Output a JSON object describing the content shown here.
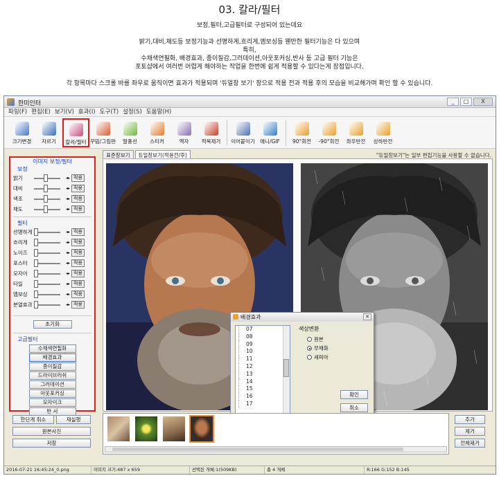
{
  "intro": {
    "heading": "03. 칼라/필터",
    "line1": "보정,필터,고급필터로 구성되어 있는데요",
    "line2": "밝기,대비,채도등 보정기능과 선명하게,흐리게,엠보싱등 웬만한 필터기능은 다 있으며",
    "line3": "특히,",
    "line4": "수채색연필화, 배경효과, 종이질감,그러데이션,아웃포커싱,반사 등 고급 필터 기능은",
    "line5": "포토샵에서 여러번 어렵게 해야하는 작업을 한번에 쉽게 적용할 수 있다는게 장점입니다.",
    "line6": "각 항목마다 스크롤 바를 좌우로 움직이면  효과가 적용되며 '듀얼창 보기' 창으로 적용 전과 적용 후의 모습을 비교해가며 확인 할 수 있습니다."
  },
  "window": {
    "title": "한미인터",
    "controls": [
      "_",
      "□",
      "X"
    ]
  },
  "menu": [
    "파일(F)",
    "편집(E)",
    "보기(V)",
    "효과(I)",
    "도구(T)",
    "설정(S)",
    "도움말(H)"
  ],
  "toolbar": [
    {
      "label": "크기변경",
      "icon": "resize-icon",
      "color": "#4a77c9"
    },
    {
      "label": "자르기",
      "icon": "crop-icon",
      "color": "#3c6fb8"
    },
    {
      "label": "칼라/필터",
      "icon": "color-filter-icon",
      "color": "#c84d7e",
      "selected": true
    },
    {
      "label": "꾸밈/그림판",
      "icon": "paint-icon",
      "color": "#d95e2e"
    },
    {
      "label": "말풍선",
      "icon": "speech-bubble-icon",
      "color": "#6fb83a"
    },
    {
      "label": "스티커",
      "icon": "sticker-icon",
      "color": "#e27b2b"
    },
    {
      "label": "액자",
      "icon": "frame-icon",
      "color": "#8a6fb0"
    },
    {
      "label": "적목제거",
      "icon": "red-eye-icon",
      "color": "#c8402a"
    },
    {
      "label": "이어붙이기",
      "icon": "merge-icon",
      "color": "#4d6fb0"
    },
    {
      "label": "애니/GIF",
      "icon": "gif-icon",
      "color": "#2f7fc9"
    },
    {
      "label": "90°회전",
      "icon": "rotate-right-icon",
      "color": "#e8a02b"
    },
    {
      "label": "-90°회전",
      "icon": "rotate-left-icon",
      "color": "#e8a02b"
    },
    {
      "label": "좌우반전",
      "icon": "flip-horizontal-icon",
      "color": "#e8a02b"
    },
    {
      "label": "상하반전",
      "icon": "flip-vertical-icon",
      "color": "#e8a02b"
    }
  ],
  "left_panel": {
    "title": "이미지 보정/필터",
    "correction_title": "보정",
    "correction": [
      {
        "label": "밝기",
        "level": 0.45
      },
      {
        "label": "대비",
        "level": 0.45
      },
      {
        "label": "색조",
        "level": 0.45
      },
      {
        "label": "채도",
        "level": 0.45
      }
    ],
    "filter_title": "필터",
    "filters": [
      {
        "label": "선명하게",
        "level": 0.0
      },
      {
        "label": "흐리게",
        "level": 0.0
      },
      {
        "label": "노이즈",
        "level": 0.0
      },
      {
        "label": "포스터",
        "level": 0.0
      },
      {
        "label": "모자이",
        "level": 0.0
      },
      {
        "label": "타일",
        "level": 0.0
      },
      {
        "label": "엠보싱",
        "level": 0.0
      },
      {
        "label": "분열효과",
        "level": 0.0
      }
    ],
    "apply_label": "적용",
    "reset_label": "초기화",
    "advanced_title": "고급필터",
    "advanced": [
      "수채색연필화",
      "배경효과",
      "종이질감",
      "드라이브러쉬",
      "그러데이션",
      "아웃포커싱",
      "모자이크",
      "반        사"
    ]
  },
  "tabs": [
    "표준창보기",
    "듀얼창보기(적용전/후)"
  ],
  "note": "\"듀얼창보기\"는 일부 편집기능을 사용할 수 없습니다.",
  "dialog": {
    "title": "배경효과",
    "list": [
      "07",
      "08",
      "09",
      "10",
      "11",
      "12",
      "13",
      "14",
      "15",
      "16",
      "17"
    ],
    "color_title": "색상변환",
    "options": [
      {
        "label": "원본",
        "checked": false
      },
      {
        "label": "무채화",
        "checked": true
      },
      {
        "label": "세피아",
        "checked": false
      }
    ],
    "ok": "확인",
    "cancel": "취소"
  },
  "bottom": {
    "undo": "한단계 취소",
    "redo": "재실행",
    "original": "원본사진",
    "save": "저장",
    "add": "추가",
    "remove": "제거",
    "remove_all": "전체제거"
  },
  "status": {
    "file": "2016-07-21 16:45:24_0.png",
    "size": "이미지 크기:487 x 659",
    "selected": "선택된 개체:1(509KB)",
    "count": "총 4 개체",
    "rgb": "R:166 G:152 B:145"
  }
}
